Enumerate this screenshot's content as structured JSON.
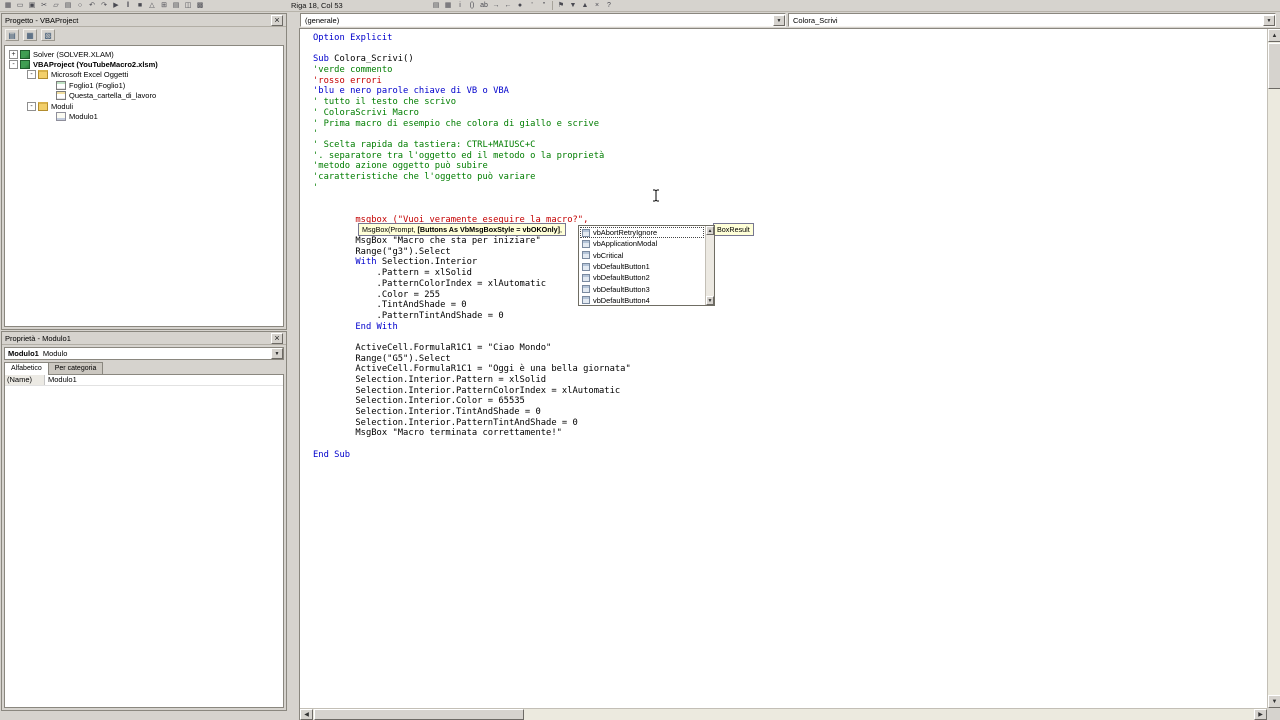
{
  "icons": {
    "up": "▲",
    "down": "▼",
    "left": "◀",
    "right": "▶",
    "close": "×",
    "dropdown": "▼"
  },
  "toolbar": {
    "position_indicator": "Riga 18, Col 53",
    "groups": [
      {
        "icons": [
          {
            "name": "excel-icon",
            "glyph": "▦"
          },
          {
            "name": "insert-userform-icon",
            "glyph": "▭"
          },
          {
            "name": "save-icon",
            "glyph": "▣"
          },
          {
            "name": "cut-icon",
            "glyph": "✂"
          },
          {
            "name": "copy-icon",
            "glyph": "▱"
          },
          {
            "name": "paste-icon",
            "glyph": "▤"
          },
          {
            "name": "find-icon",
            "glyph": "○"
          },
          {
            "name": "undo-icon",
            "glyph": "↶"
          },
          {
            "name": "redo-icon",
            "glyph": "↷"
          },
          {
            "name": "run-icon",
            "glyph": "▶"
          },
          {
            "name": "break-icon",
            "glyph": "‖"
          },
          {
            "name": "reset-icon",
            "glyph": "■"
          },
          {
            "name": "design-mode-icon",
            "glyph": "△"
          },
          {
            "name": "project-explorer-icon",
            "glyph": "⊞"
          },
          {
            "name": "properties-window-icon",
            "glyph": "▤"
          },
          {
            "name": "object-browser-icon",
            "glyph": "◫"
          },
          {
            "name": "toolbox-icon",
            "glyph": "▩"
          }
        ]
      },
      {
        "icons": [
          {
            "name": "list-properties-icon",
            "glyph": "▤"
          },
          {
            "name": "list-constants-icon",
            "glyph": "▦"
          },
          {
            "name": "quick-info-icon",
            "glyph": "i"
          },
          {
            "name": "parameter-info-icon",
            "glyph": "()"
          },
          {
            "name": "complete-word-icon",
            "glyph": "ab"
          },
          {
            "name": "indent-icon",
            "glyph": "→"
          },
          {
            "name": "outdent-icon",
            "glyph": "←"
          },
          {
            "name": "toggle-breakpoint-icon",
            "glyph": "●"
          },
          {
            "name": "comment-block-icon",
            "glyph": "'"
          },
          {
            "name": "uncomment-block-icon",
            "glyph": "''"
          }
        ]
      },
      {
        "icons": [
          {
            "name": "toggle-bookmark-icon",
            "glyph": "⚑"
          },
          {
            "name": "next-bookmark-icon",
            "glyph": "▼"
          },
          {
            "name": "previous-bookmark-icon",
            "glyph": "▲"
          },
          {
            "name": "clear-bookmarks-icon",
            "glyph": "×"
          },
          {
            "name": "help-icon",
            "glyph": "?"
          }
        ]
      }
    ]
  },
  "project_panel": {
    "title": "Progetto - VBAProject",
    "toolbar_icons": [
      {
        "name": "view-code-icon",
        "glyph": "▤"
      },
      {
        "name": "view-object-icon",
        "glyph": "▦"
      },
      {
        "name": "toggle-folders-icon",
        "glyph": "▧"
      }
    ],
    "tree": [
      {
        "label": "Solver (SOLVER.XLAM)",
        "level": 0,
        "expander": "+",
        "icon": "project",
        "bold": false
      },
      {
        "label": "VBAProject (YouTubeMacro2.xlsm)",
        "level": 0,
        "expander": "-",
        "icon": "project",
        "bold": true
      },
      {
        "label": "Microsoft Excel Oggetti",
        "level": 1,
        "expander": "-",
        "icon": "folder",
        "bold": false
      },
      {
        "label": "Foglio1 (Foglio1)",
        "level": 2,
        "expander": null,
        "icon": "sheet",
        "bold": false
      },
      {
        "label": "Questa_cartella_di_lavoro",
        "level": 2,
        "expander": null,
        "icon": "workbook",
        "bold": false
      },
      {
        "label": "Moduli",
        "level": 1,
        "expander": "-",
        "icon": "folder",
        "bold": false
      },
      {
        "label": "Modulo1",
        "level": 2,
        "expander": null,
        "icon": "module",
        "bold": false
      }
    ]
  },
  "properties_panel": {
    "title": "Proprietà - Modulo1",
    "object_name": "Modulo1",
    "object_type": "Modulo",
    "tabs": [
      "Alfabetico",
      "Per categoria"
    ],
    "rows": [
      {
        "name": "(Name)",
        "value": "Modulo1"
      }
    ]
  },
  "code_window": {
    "object_dropdown": "(generale)",
    "procedure_dropdown": "Colora_Scrivi",
    "tooltip": {
      "pre": "MsgBox(Prompt, ",
      "bold": "[Buttons As VbMsgBoxStyle = vbOKOnly]",
      "post": ",",
      "tail": "BoxResult"
    },
    "autocomplete": {
      "selected_index": 0,
      "items": [
        "vbAbortRetryIgnore",
        "vbApplicationModal",
        "vbCritical",
        "vbDefaultButton1",
        "vbDefaultButton2",
        "vbDefaultButton3",
        "vbDefaultButton4"
      ]
    },
    "lines": [
      {
        "segs": [
          {
            "t": "Option Explicit",
            "c": "k"
          }
        ]
      },
      {
        "segs": []
      },
      {
        "segs": [
          {
            "t": "Sub",
            "c": "k"
          },
          {
            "t": " Colora_Scrivi()",
            "c": "n"
          }
        ]
      },
      {
        "segs": [
          {
            "t": "'verde commento",
            "c": "c"
          }
        ]
      },
      {
        "segs": [
          {
            "t": "'rosso errori",
            "c": "e"
          }
        ]
      },
      {
        "segs": [
          {
            "t": "'blu e nero parole chiave di VB o VBA",
            "c": "k"
          }
        ]
      },
      {
        "segs": [
          {
            "t": "' tutto il testo che scrivo",
            "c": "c"
          }
        ]
      },
      {
        "segs": [
          {
            "t": "' ColoraScrivi Macro",
            "c": "c"
          }
        ]
      },
      {
        "segs": [
          {
            "t": "' Prima macro di esempio che colora di giallo e scrive",
            "c": "c"
          }
        ]
      },
      {
        "segs": [
          {
            "t": "'",
            "c": "c"
          }
        ]
      },
      {
        "segs": [
          {
            "t": "' Scelta rapida da tastiera: CTRL+MAIUSC+C",
            "c": "c"
          }
        ]
      },
      {
        "segs": [
          {
            "t": "'. separatore tra l'oggetto ed il metodo o la proprietà",
            "c": "c"
          }
        ]
      },
      {
        "segs": [
          {
            "t": "'metodo azione oggetto può subire",
            "c": "c"
          }
        ]
      },
      {
        "segs": [
          {
            "t": "'caratteristiche che l'oggetto può variare",
            "c": "c"
          }
        ]
      },
      {
        "segs": [
          {
            "t": "'",
            "c": "c"
          }
        ]
      },
      {
        "segs": []
      },
      {
        "segs": []
      },
      {
        "segs": [
          {
            "t": "        msgbox (\"Vuoi veramente eseguire la macro?\",",
            "c": "e"
          }
        ]
      },
      {
        "segs": []
      },
      {
        "segs": [
          {
            "t": "        MsgBox \"Macro che sta per iniziare\"",
            "c": "n"
          }
        ]
      },
      {
        "segs": [
          {
            "t": "        Range(\"g3\").Select",
            "c": "n"
          }
        ]
      },
      {
        "segs": [
          {
            "t": "        ",
            "c": "n"
          },
          {
            "t": "With",
            "c": "k"
          },
          {
            "t": " Selection.Interior",
            "c": "n"
          }
        ]
      },
      {
        "segs": [
          {
            "t": "            .Pattern = xlSolid",
            "c": "n"
          }
        ]
      },
      {
        "segs": [
          {
            "t": "            .PatternColorIndex = xlAutomatic",
            "c": "n"
          }
        ]
      },
      {
        "segs": [
          {
            "t": "            .Color = 255",
            "c": "n"
          }
        ]
      },
      {
        "segs": [
          {
            "t": "            .TintAndShade = 0",
            "c": "n"
          }
        ]
      },
      {
        "segs": [
          {
            "t": "            .PatternTintAndShade = 0",
            "c": "n"
          }
        ]
      },
      {
        "segs": [
          {
            "t": "        ",
            "c": "n"
          },
          {
            "t": "End With",
            "c": "k"
          }
        ]
      },
      {
        "segs": []
      },
      {
        "segs": [
          {
            "t": "        ActiveCell.FormulaR1C1 = \"Ciao Mondo\"",
            "c": "n"
          }
        ]
      },
      {
        "segs": [
          {
            "t": "        Range(\"G5\").Select",
            "c": "n"
          }
        ]
      },
      {
        "segs": [
          {
            "t": "        ActiveCell.FormulaR1C1 = \"Oggi è una bella giornata\"",
            "c": "n"
          }
        ]
      },
      {
        "segs": [
          {
            "t": "        Selection.Interior.Pattern = xlSolid",
            "c": "n"
          }
        ]
      },
      {
        "segs": [
          {
            "t": "        Selection.Interior.PatternColorIndex = xlAutomatic",
            "c": "n"
          }
        ]
      },
      {
        "segs": [
          {
            "t": "        Selection.Interior.Color = 65535",
            "c": "n"
          }
        ]
      },
      {
        "segs": [
          {
            "t": "        Selection.Interior.TintAndShade = 0",
            "c": "n"
          }
        ]
      },
      {
        "segs": [
          {
            "t": "        Selection.Interior.PatternTintAndShade = 0",
            "c": "n"
          }
        ]
      },
      {
        "segs": [
          {
            "t": "        MsgBox \"Macro terminata correttamente!\"",
            "c": "n"
          }
        ]
      },
      {
        "segs": []
      },
      {
        "segs": [
          {
            "t": "End Sub",
            "c": "k"
          }
        ]
      }
    ]
  }
}
